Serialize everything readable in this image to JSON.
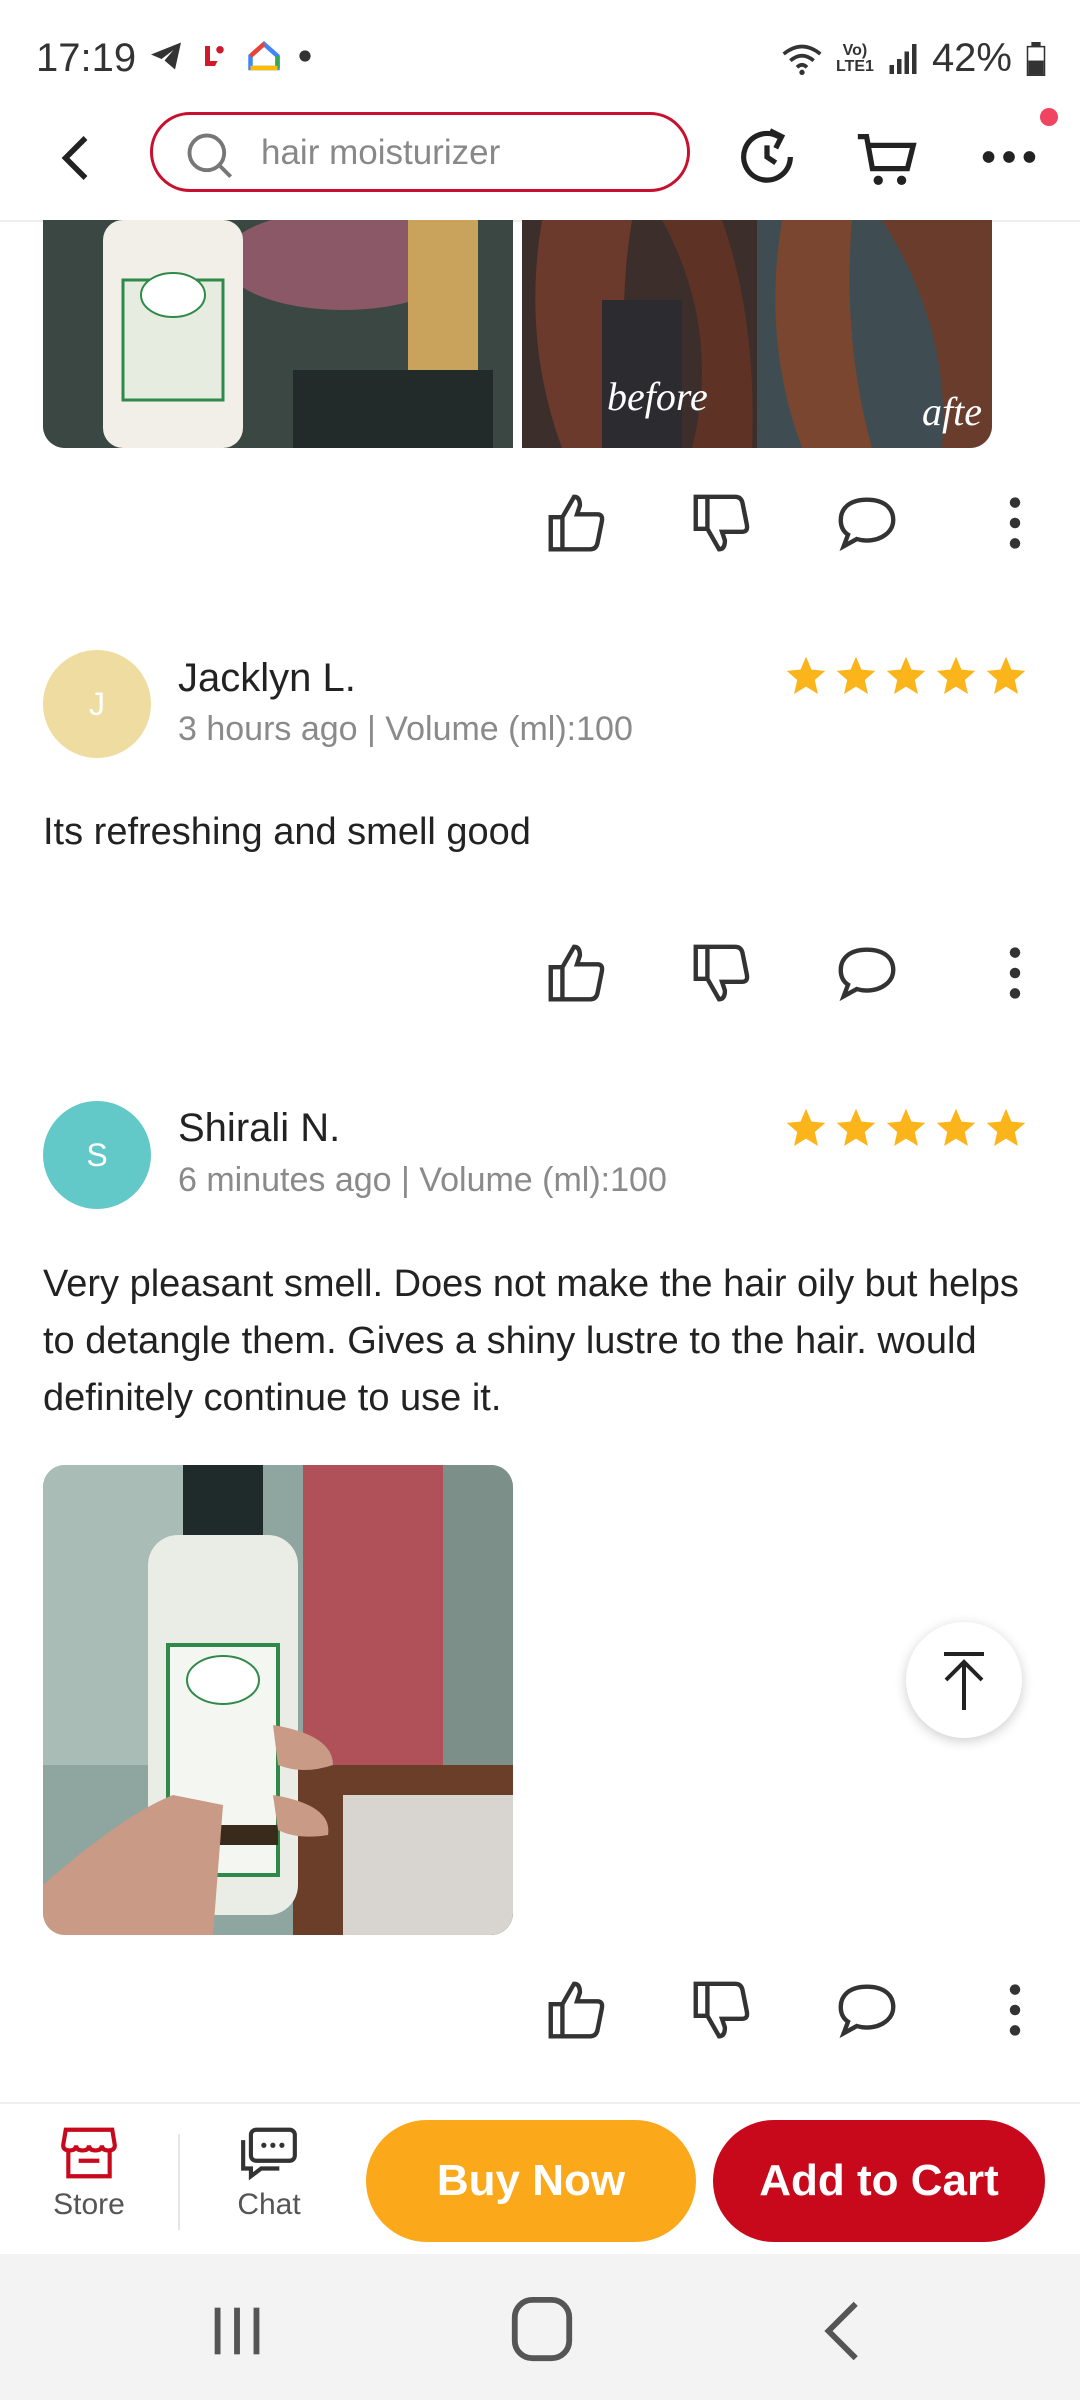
{
  "status_bar": {
    "time": "17:19",
    "lte": "Vo)\nLTE1",
    "battery": "42%"
  },
  "header": {
    "search_text": "hair moisturizer"
  },
  "reviews": [
    {
      "initial": "J",
      "avatar_color": "#efdca0",
      "name": "Jacklyn L.",
      "meta": "3  hours ago | Volume (ml):100",
      "rating": 5,
      "text": "Its refreshing and smell good"
    },
    {
      "initial": "S",
      "avatar_color": "#62c9c8",
      "name": "Shirali N.",
      "meta": "6  minutes ago | Volume (ml):100",
      "rating": 5,
      "text": "Very pleasant smell. Does not make the hair oily but helps to detangle them. Gives a shiny lustre to the hair. would definitely continue to use it."
    }
  ],
  "photo_labels": {
    "before": "before",
    "after": "afte"
  },
  "bottom_bar": {
    "store_label": "Store",
    "chat_label": "Chat",
    "buy_now": "Buy Now",
    "add_to_cart": "Add to Cart"
  },
  "colors": {
    "accent": "#c8081b",
    "buy": "#fba91b",
    "star": "#fbb51b"
  }
}
